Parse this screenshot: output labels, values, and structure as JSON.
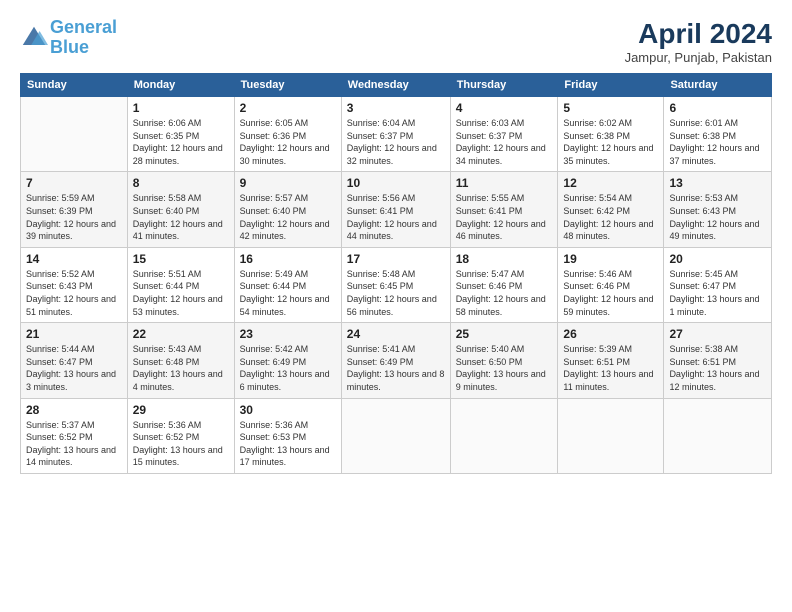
{
  "logo": {
    "line1": "General",
    "line2": "Blue"
  },
  "title": "April 2024",
  "subtitle": "Jampur, Punjab, Pakistan",
  "days_of_week": [
    "Sunday",
    "Monday",
    "Tuesday",
    "Wednesday",
    "Thursday",
    "Friday",
    "Saturday"
  ],
  "weeks": [
    [
      {
        "day": "",
        "sunrise": "",
        "sunset": "",
        "daylight": ""
      },
      {
        "day": "1",
        "sunrise": "Sunrise: 6:06 AM",
        "sunset": "Sunset: 6:35 PM",
        "daylight": "Daylight: 12 hours and 28 minutes."
      },
      {
        "day": "2",
        "sunrise": "Sunrise: 6:05 AM",
        "sunset": "Sunset: 6:36 PM",
        "daylight": "Daylight: 12 hours and 30 minutes."
      },
      {
        "day": "3",
        "sunrise": "Sunrise: 6:04 AM",
        "sunset": "Sunset: 6:37 PM",
        "daylight": "Daylight: 12 hours and 32 minutes."
      },
      {
        "day": "4",
        "sunrise": "Sunrise: 6:03 AM",
        "sunset": "Sunset: 6:37 PM",
        "daylight": "Daylight: 12 hours and 34 minutes."
      },
      {
        "day": "5",
        "sunrise": "Sunrise: 6:02 AM",
        "sunset": "Sunset: 6:38 PM",
        "daylight": "Daylight: 12 hours and 35 minutes."
      },
      {
        "day": "6",
        "sunrise": "Sunrise: 6:01 AM",
        "sunset": "Sunset: 6:38 PM",
        "daylight": "Daylight: 12 hours and 37 minutes."
      }
    ],
    [
      {
        "day": "7",
        "sunrise": "Sunrise: 5:59 AM",
        "sunset": "Sunset: 6:39 PM",
        "daylight": "Daylight: 12 hours and 39 minutes."
      },
      {
        "day": "8",
        "sunrise": "Sunrise: 5:58 AM",
        "sunset": "Sunset: 6:40 PM",
        "daylight": "Daylight: 12 hours and 41 minutes."
      },
      {
        "day": "9",
        "sunrise": "Sunrise: 5:57 AM",
        "sunset": "Sunset: 6:40 PM",
        "daylight": "Daylight: 12 hours and 42 minutes."
      },
      {
        "day": "10",
        "sunrise": "Sunrise: 5:56 AM",
        "sunset": "Sunset: 6:41 PM",
        "daylight": "Daylight: 12 hours and 44 minutes."
      },
      {
        "day": "11",
        "sunrise": "Sunrise: 5:55 AM",
        "sunset": "Sunset: 6:41 PM",
        "daylight": "Daylight: 12 hours and 46 minutes."
      },
      {
        "day": "12",
        "sunrise": "Sunrise: 5:54 AM",
        "sunset": "Sunset: 6:42 PM",
        "daylight": "Daylight: 12 hours and 48 minutes."
      },
      {
        "day": "13",
        "sunrise": "Sunrise: 5:53 AM",
        "sunset": "Sunset: 6:43 PM",
        "daylight": "Daylight: 12 hours and 49 minutes."
      }
    ],
    [
      {
        "day": "14",
        "sunrise": "Sunrise: 5:52 AM",
        "sunset": "Sunset: 6:43 PM",
        "daylight": "Daylight: 12 hours and 51 minutes."
      },
      {
        "day": "15",
        "sunrise": "Sunrise: 5:51 AM",
        "sunset": "Sunset: 6:44 PM",
        "daylight": "Daylight: 12 hours and 53 minutes."
      },
      {
        "day": "16",
        "sunrise": "Sunrise: 5:49 AM",
        "sunset": "Sunset: 6:44 PM",
        "daylight": "Daylight: 12 hours and 54 minutes."
      },
      {
        "day": "17",
        "sunrise": "Sunrise: 5:48 AM",
        "sunset": "Sunset: 6:45 PM",
        "daylight": "Daylight: 12 hours and 56 minutes."
      },
      {
        "day": "18",
        "sunrise": "Sunrise: 5:47 AM",
        "sunset": "Sunset: 6:46 PM",
        "daylight": "Daylight: 12 hours and 58 minutes."
      },
      {
        "day": "19",
        "sunrise": "Sunrise: 5:46 AM",
        "sunset": "Sunset: 6:46 PM",
        "daylight": "Daylight: 12 hours and 59 minutes."
      },
      {
        "day": "20",
        "sunrise": "Sunrise: 5:45 AM",
        "sunset": "Sunset: 6:47 PM",
        "daylight": "Daylight: 13 hours and 1 minute."
      }
    ],
    [
      {
        "day": "21",
        "sunrise": "Sunrise: 5:44 AM",
        "sunset": "Sunset: 6:47 PM",
        "daylight": "Daylight: 13 hours and 3 minutes."
      },
      {
        "day": "22",
        "sunrise": "Sunrise: 5:43 AM",
        "sunset": "Sunset: 6:48 PM",
        "daylight": "Daylight: 13 hours and 4 minutes."
      },
      {
        "day": "23",
        "sunrise": "Sunrise: 5:42 AM",
        "sunset": "Sunset: 6:49 PM",
        "daylight": "Daylight: 13 hours and 6 minutes."
      },
      {
        "day": "24",
        "sunrise": "Sunrise: 5:41 AM",
        "sunset": "Sunset: 6:49 PM",
        "daylight": "Daylight: 13 hours and 8 minutes."
      },
      {
        "day": "25",
        "sunrise": "Sunrise: 5:40 AM",
        "sunset": "Sunset: 6:50 PM",
        "daylight": "Daylight: 13 hours and 9 minutes."
      },
      {
        "day": "26",
        "sunrise": "Sunrise: 5:39 AM",
        "sunset": "Sunset: 6:51 PM",
        "daylight": "Daylight: 13 hours and 11 minutes."
      },
      {
        "day": "27",
        "sunrise": "Sunrise: 5:38 AM",
        "sunset": "Sunset: 6:51 PM",
        "daylight": "Daylight: 13 hours and 12 minutes."
      }
    ],
    [
      {
        "day": "28",
        "sunrise": "Sunrise: 5:37 AM",
        "sunset": "Sunset: 6:52 PM",
        "daylight": "Daylight: 13 hours and 14 minutes."
      },
      {
        "day": "29",
        "sunrise": "Sunrise: 5:36 AM",
        "sunset": "Sunset: 6:52 PM",
        "daylight": "Daylight: 13 hours and 15 minutes."
      },
      {
        "day": "30",
        "sunrise": "Sunrise: 5:36 AM",
        "sunset": "Sunset: 6:53 PM",
        "daylight": "Daylight: 13 hours and 17 minutes."
      },
      {
        "day": "",
        "sunrise": "",
        "sunset": "",
        "daylight": ""
      },
      {
        "day": "",
        "sunrise": "",
        "sunset": "",
        "daylight": ""
      },
      {
        "day": "",
        "sunrise": "",
        "sunset": "",
        "daylight": ""
      },
      {
        "day": "",
        "sunrise": "",
        "sunset": "",
        "daylight": ""
      }
    ]
  ]
}
